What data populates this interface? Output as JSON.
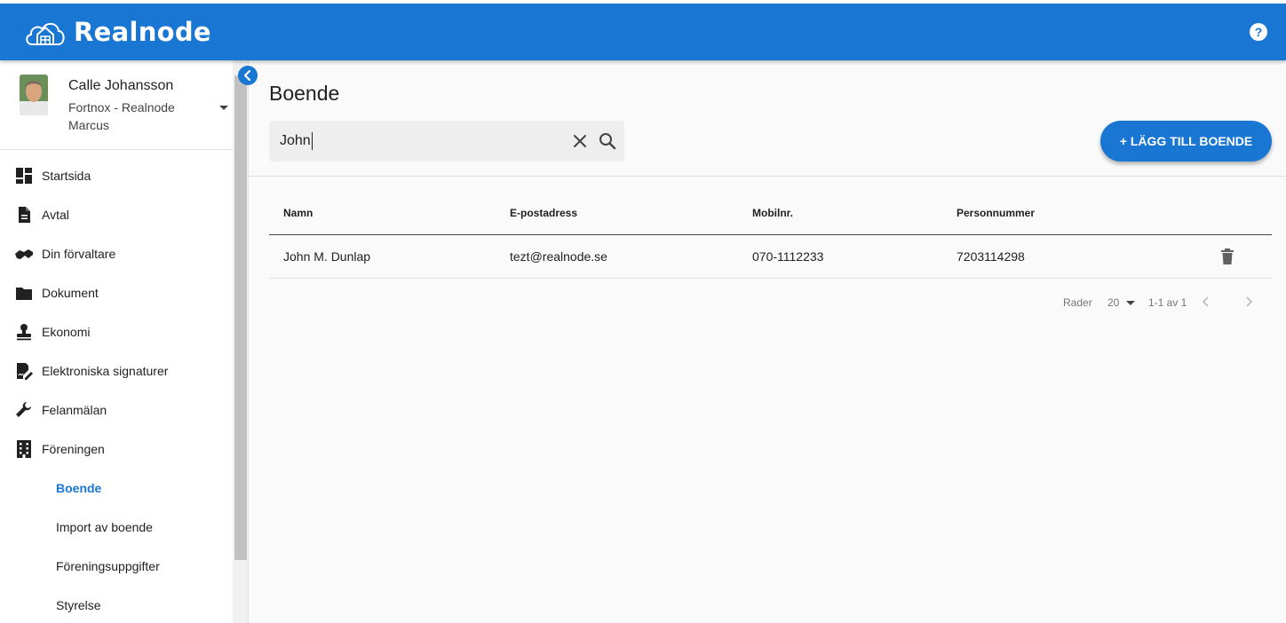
{
  "app": {
    "brand": "Realnode"
  },
  "header": {
    "logo_icon": "house-cloud-logo",
    "help_icon": "help-circle-icon"
  },
  "user": {
    "name": "Calle Johansson",
    "org": "Fortnox - Realnode",
    "sub": "Marcus"
  },
  "nav": [
    {
      "label": "Startsida",
      "icon": "dashboard-icon"
    },
    {
      "label": "Avtal",
      "icon": "document-icon"
    },
    {
      "label": "Din förvaltare",
      "icon": "handshake-icon"
    },
    {
      "label": "Dokument",
      "icon": "folder-icon"
    },
    {
      "label": "Ekonomi",
      "icon": "stamp-icon"
    },
    {
      "label": "Elektroniska signaturer",
      "icon": "signature-icon"
    },
    {
      "label": "Felanmälan",
      "icon": "wrench-icon"
    },
    {
      "label": "Föreningen",
      "icon": "building-icon"
    }
  ],
  "subnav": [
    {
      "label": "Boende",
      "active": true
    },
    {
      "label": "Import av boende",
      "active": false
    },
    {
      "label": "Föreningsuppgifter",
      "active": false
    },
    {
      "label": "Styrelse",
      "active": false
    }
  ],
  "page": {
    "title": "Boende",
    "search_value": "John",
    "add_button": "+ LÄGG TILL BOENDE"
  },
  "table": {
    "columns": [
      "Namn",
      "E-postadress",
      "Mobilnr.",
      "Personnummer"
    ],
    "rows": [
      {
        "name": "John M. Dunlap",
        "email": "tezt@realnode.se",
        "mobile": "070-1112233",
        "personnummer": "7203114298"
      }
    ]
  },
  "pagination": {
    "rows_label": "Rader",
    "rows_per_page": "20",
    "range": "1-1 av 1"
  },
  "colors": {
    "primary": "#1976d2"
  }
}
